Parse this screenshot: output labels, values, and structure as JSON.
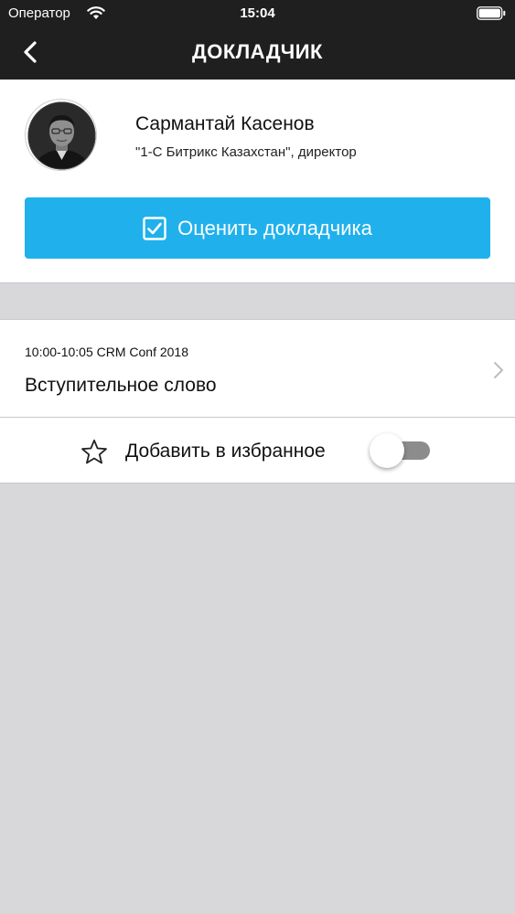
{
  "status_bar": {
    "carrier": "Оператор",
    "time": "15:04"
  },
  "nav": {
    "title": "ДОКЛАДЧИК"
  },
  "speaker": {
    "name": "Сармантай Касенов",
    "role": "\"1-С Битрикс Казахстан\", директор",
    "rate_button_label": "Оценить докладчика"
  },
  "session": {
    "time_info": "10:00-10:05 CRM Conf 2018",
    "title": "Вступительное слово"
  },
  "favorite": {
    "label": "Добавить в избранное",
    "enabled": false
  },
  "colors": {
    "header_bg": "#1f1f1f",
    "accent": "#20b1ed",
    "page_bg": "#d8d7da",
    "toggle_off": "#8c8c8c"
  }
}
